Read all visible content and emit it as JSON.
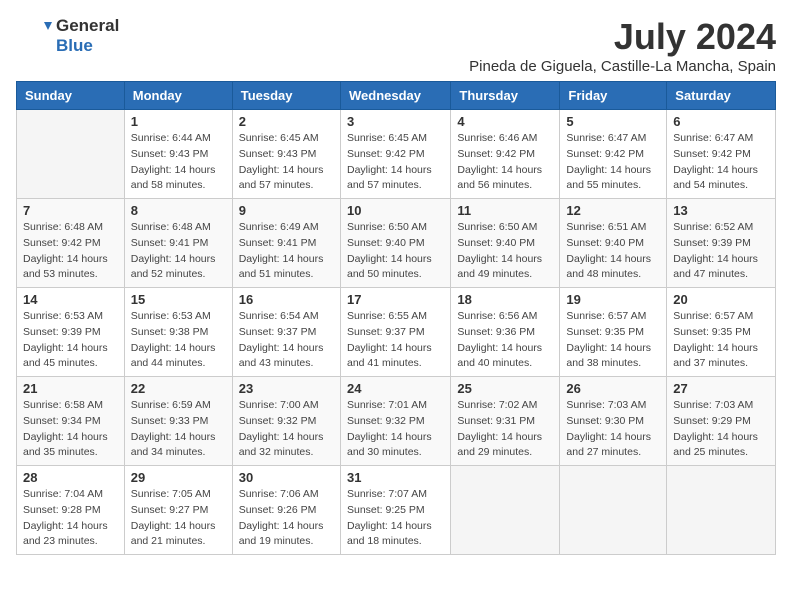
{
  "header": {
    "logo_general": "General",
    "logo_blue": "Blue",
    "month_title": "July 2024",
    "location": "Pineda de Giguela, Castille-La Mancha, Spain"
  },
  "weekdays": [
    "Sunday",
    "Monday",
    "Tuesday",
    "Wednesday",
    "Thursday",
    "Friday",
    "Saturday"
  ],
  "weeks": [
    [
      {
        "day": "",
        "empty": true
      },
      {
        "day": "1",
        "sunrise": "Sunrise: 6:44 AM",
        "sunset": "Sunset: 9:43 PM",
        "daylight": "Daylight: 14 hours and 58 minutes."
      },
      {
        "day": "2",
        "sunrise": "Sunrise: 6:45 AM",
        "sunset": "Sunset: 9:43 PM",
        "daylight": "Daylight: 14 hours and 57 minutes."
      },
      {
        "day": "3",
        "sunrise": "Sunrise: 6:45 AM",
        "sunset": "Sunset: 9:42 PM",
        "daylight": "Daylight: 14 hours and 57 minutes."
      },
      {
        "day": "4",
        "sunrise": "Sunrise: 6:46 AM",
        "sunset": "Sunset: 9:42 PM",
        "daylight": "Daylight: 14 hours and 56 minutes."
      },
      {
        "day": "5",
        "sunrise": "Sunrise: 6:47 AM",
        "sunset": "Sunset: 9:42 PM",
        "daylight": "Daylight: 14 hours and 55 minutes."
      },
      {
        "day": "6",
        "sunrise": "Sunrise: 6:47 AM",
        "sunset": "Sunset: 9:42 PM",
        "daylight": "Daylight: 14 hours and 54 minutes."
      }
    ],
    [
      {
        "day": "7",
        "sunrise": "Sunrise: 6:48 AM",
        "sunset": "Sunset: 9:42 PM",
        "daylight": "Daylight: 14 hours and 53 minutes."
      },
      {
        "day": "8",
        "sunrise": "Sunrise: 6:48 AM",
        "sunset": "Sunset: 9:41 PM",
        "daylight": "Daylight: 14 hours and 52 minutes."
      },
      {
        "day": "9",
        "sunrise": "Sunrise: 6:49 AM",
        "sunset": "Sunset: 9:41 PM",
        "daylight": "Daylight: 14 hours and 51 minutes."
      },
      {
        "day": "10",
        "sunrise": "Sunrise: 6:50 AM",
        "sunset": "Sunset: 9:40 PM",
        "daylight": "Daylight: 14 hours and 50 minutes."
      },
      {
        "day": "11",
        "sunrise": "Sunrise: 6:50 AM",
        "sunset": "Sunset: 9:40 PM",
        "daylight": "Daylight: 14 hours and 49 minutes."
      },
      {
        "day": "12",
        "sunrise": "Sunrise: 6:51 AM",
        "sunset": "Sunset: 9:40 PM",
        "daylight": "Daylight: 14 hours and 48 minutes."
      },
      {
        "day": "13",
        "sunrise": "Sunrise: 6:52 AM",
        "sunset": "Sunset: 9:39 PM",
        "daylight": "Daylight: 14 hours and 47 minutes."
      }
    ],
    [
      {
        "day": "14",
        "sunrise": "Sunrise: 6:53 AM",
        "sunset": "Sunset: 9:39 PM",
        "daylight": "Daylight: 14 hours and 45 minutes."
      },
      {
        "day": "15",
        "sunrise": "Sunrise: 6:53 AM",
        "sunset": "Sunset: 9:38 PM",
        "daylight": "Daylight: 14 hours and 44 minutes."
      },
      {
        "day": "16",
        "sunrise": "Sunrise: 6:54 AM",
        "sunset": "Sunset: 9:37 PM",
        "daylight": "Daylight: 14 hours and 43 minutes."
      },
      {
        "day": "17",
        "sunrise": "Sunrise: 6:55 AM",
        "sunset": "Sunset: 9:37 PM",
        "daylight": "Daylight: 14 hours and 41 minutes."
      },
      {
        "day": "18",
        "sunrise": "Sunrise: 6:56 AM",
        "sunset": "Sunset: 9:36 PM",
        "daylight": "Daylight: 14 hours and 40 minutes."
      },
      {
        "day": "19",
        "sunrise": "Sunrise: 6:57 AM",
        "sunset": "Sunset: 9:35 PM",
        "daylight": "Daylight: 14 hours and 38 minutes."
      },
      {
        "day": "20",
        "sunrise": "Sunrise: 6:57 AM",
        "sunset": "Sunset: 9:35 PM",
        "daylight": "Daylight: 14 hours and 37 minutes."
      }
    ],
    [
      {
        "day": "21",
        "sunrise": "Sunrise: 6:58 AM",
        "sunset": "Sunset: 9:34 PM",
        "daylight": "Daylight: 14 hours and 35 minutes."
      },
      {
        "day": "22",
        "sunrise": "Sunrise: 6:59 AM",
        "sunset": "Sunset: 9:33 PM",
        "daylight": "Daylight: 14 hours and 34 minutes."
      },
      {
        "day": "23",
        "sunrise": "Sunrise: 7:00 AM",
        "sunset": "Sunset: 9:32 PM",
        "daylight": "Daylight: 14 hours and 32 minutes."
      },
      {
        "day": "24",
        "sunrise": "Sunrise: 7:01 AM",
        "sunset": "Sunset: 9:32 PM",
        "daylight": "Daylight: 14 hours and 30 minutes."
      },
      {
        "day": "25",
        "sunrise": "Sunrise: 7:02 AM",
        "sunset": "Sunset: 9:31 PM",
        "daylight": "Daylight: 14 hours and 29 minutes."
      },
      {
        "day": "26",
        "sunrise": "Sunrise: 7:03 AM",
        "sunset": "Sunset: 9:30 PM",
        "daylight": "Daylight: 14 hours and 27 minutes."
      },
      {
        "day": "27",
        "sunrise": "Sunrise: 7:03 AM",
        "sunset": "Sunset: 9:29 PM",
        "daylight": "Daylight: 14 hours and 25 minutes."
      }
    ],
    [
      {
        "day": "28",
        "sunrise": "Sunrise: 7:04 AM",
        "sunset": "Sunset: 9:28 PM",
        "daylight": "Daylight: 14 hours and 23 minutes."
      },
      {
        "day": "29",
        "sunrise": "Sunrise: 7:05 AM",
        "sunset": "Sunset: 9:27 PM",
        "daylight": "Daylight: 14 hours and 21 minutes."
      },
      {
        "day": "30",
        "sunrise": "Sunrise: 7:06 AM",
        "sunset": "Sunset: 9:26 PM",
        "daylight": "Daylight: 14 hours and 19 minutes."
      },
      {
        "day": "31",
        "sunrise": "Sunrise: 7:07 AM",
        "sunset": "Sunset: 9:25 PM",
        "daylight": "Daylight: 14 hours and 18 minutes."
      },
      {
        "day": "",
        "empty": true
      },
      {
        "day": "",
        "empty": true
      },
      {
        "day": "",
        "empty": true
      }
    ]
  ]
}
